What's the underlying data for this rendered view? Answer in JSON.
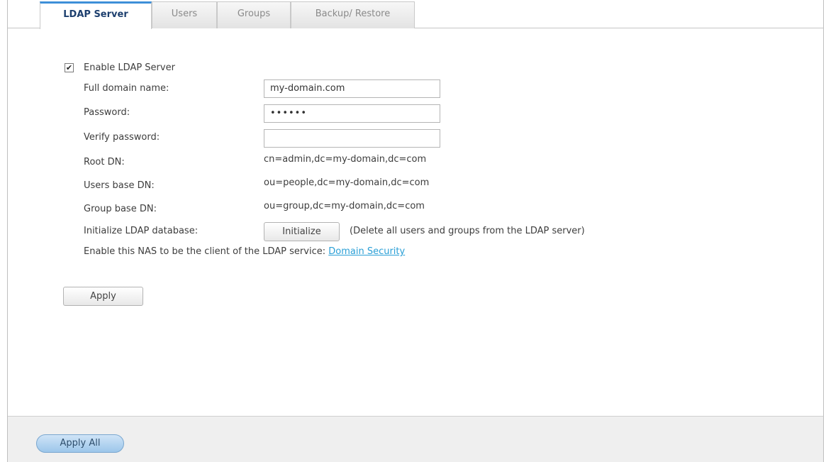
{
  "tabs": [
    {
      "label": "LDAP Server",
      "active": true
    },
    {
      "label": "Users",
      "active": false
    },
    {
      "label": "Groups",
      "active": false
    },
    {
      "label": "Backup/ Restore",
      "active": false
    }
  ],
  "form": {
    "enable_label": "Enable LDAP Server",
    "enable_checked": true,
    "checkbox_glyph": "✔",
    "full_domain_label": "Full domain name:",
    "full_domain_value": "my-domain.com",
    "password_label": "Password:",
    "password_value": "••••••",
    "verify_password_label": "Verify password:",
    "verify_password_value": "",
    "root_dn_label": "Root DN:",
    "root_dn_value": "cn=admin,dc=my-domain,dc=com",
    "users_base_dn_label": "Users base DN:",
    "users_base_dn_value": "ou=people,dc=my-domain,dc=com",
    "group_base_dn_label": "Group base DN:",
    "group_base_dn_value": "ou=group,dc=my-domain,dc=com",
    "init_label": "Initialize LDAP database:",
    "init_button": "Initialize",
    "init_note": "(Delete all users and groups from the LDAP server)",
    "client_text": "Enable this NAS to be the client of the LDAP service:",
    "client_link": "Domain Security",
    "apply_button": "Apply"
  },
  "footer": {
    "apply_all_button": "Apply All"
  },
  "colors": {
    "active_tab_accent": "#3d8fd8",
    "link": "#2a9fd6",
    "apply_all_bg": "#9cc6ea"
  }
}
